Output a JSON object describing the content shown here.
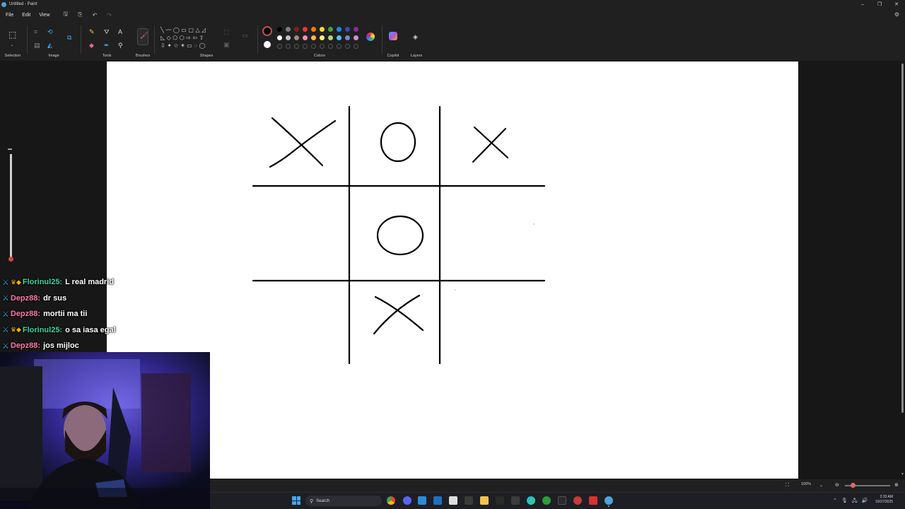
{
  "window": {
    "title": "Untitled - Paint",
    "controls": [
      "–",
      "❐",
      "✕"
    ]
  },
  "menu": {
    "items": [
      "File",
      "Edit",
      "View"
    ]
  },
  "ribbon": {
    "groups": [
      {
        "label": "Selection"
      },
      {
        "label": "Image"
      },
      {
        "label": "Tools"
      },
      {
        "label": "Brushes"
      },
      {
        "label": "Shapes"
      },
      {
        "label": "Colors"
      },
      {
        "label": "Copilot"
      },
      {
        "label": "Layers"
      }
    ],
    "colors_row1": [
      "#000000",
      "#7f7f7f",
      "#8b1a1a",
      "#e53935",
      "#f57c00",
      "#fdd835",
      "#43a047",
      "#1e88e5",
      "#3949ab",
      "#8e24aa"
    ],
    "colors_row2": [
      "#ffffff",
      "#c3c3c3",
      "#a1887f",
      "#f48fb1",
      "#ffb74d",
      "#fff176",
      "#aed581",
      "#4fc3f7",
      "#7986cb",
      "#ce93d8"
    ]
  },
  "canvas": {
    "board": [
      [
        "X",
        "O",
        "X"
      ],
      [
        "",
        "O",
        ""
      ],
      [
        "",
        "X",
        ""
      ]
    ]
  },
  "statusbar": {
    "zoom": "100%"
  },
  "taskbar": {
    "search_placeholder": "Search",
    "time": "2:33 AM",
    "date": "10/27/2025"
  },
  "chat": {
    "messages": [
      {
        "user": "Florinul25:",
        "text": "L real madrid",
        "color": "#3ed6a0",
        "crown": true
      },
      {
        "user": "Depz88:",
        "text": "dr sus",
        "color": "#ff7aa8",
        "crown": false
      },
      {
        "user": "Depz88:",
        "text": "mortii ma tii",
        "color": "#ff7aa8",
        "crown": false
      },
      {
        "user": "Florinul25:",
        "text": "o sa iasa egal",
        "color": "#3ed6a0",
        "crown": true
      },
      {
        "user": "Depz88:",
        "text": "jos mijloc",
        "color": "#ff7aa8",
        "crown": false
      }
    ]
  }
}
